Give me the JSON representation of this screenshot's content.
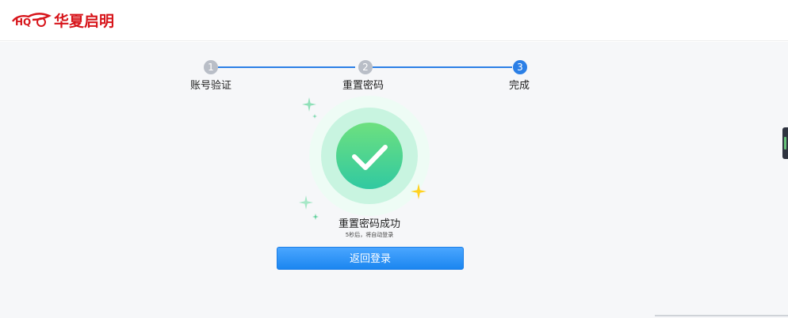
{
  "header": {
    "logo_letters": "HQ",
    "brand_name": "华夏启明",
    "colors": {
      "brand_red": "#d7141a"
    }
  },
  "steps": [
    {
      "number": "1",
      "label": "账号验证",
      "state": "done"
    },
    {
      "number": "2",
      "label": "重置密码",
      "state": "done"
    },
    {
      "number": "3",
      "label": "完成",
      "state": "active"
    }
  ],
  "result": {
    "icon": "check-circle-icon",
    "title": "重置密码成功",
    "subtitle": "5秒后，将自动登录"
  },
  "actions": {
    "back_to_login_label": "返回登录"
  },
  "colors": {
    "accent": "#2b7fe6",
    "success_green": "#47d38f",
    "sparkle_yellow": "#ffd21f"
  }
}
